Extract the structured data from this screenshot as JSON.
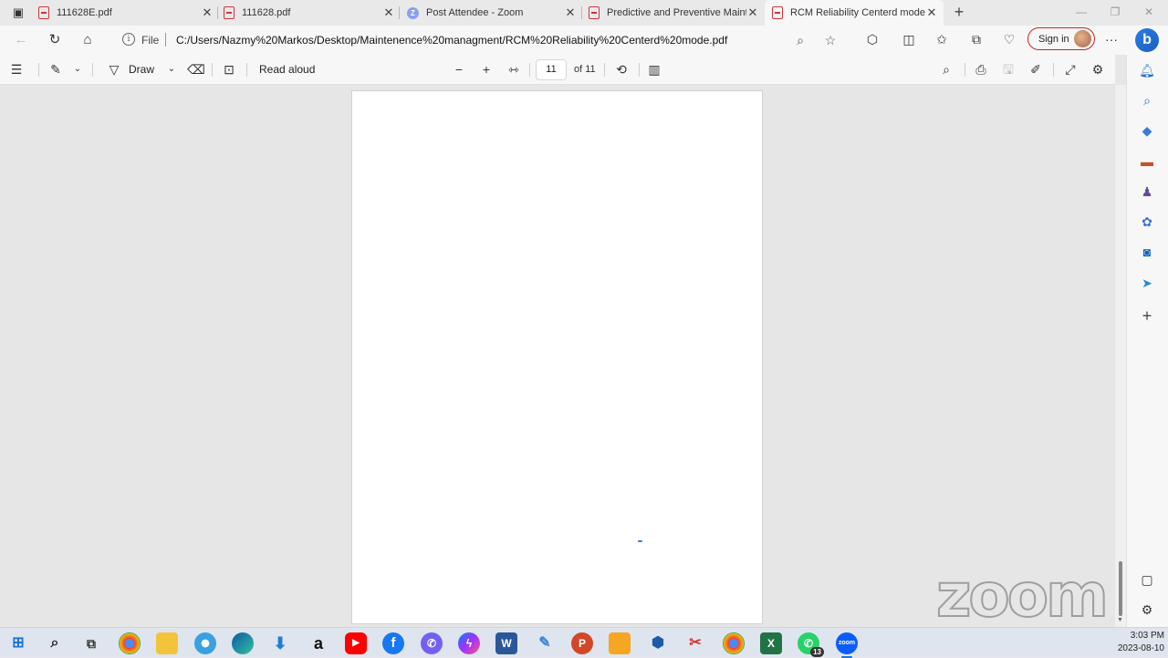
{
  "tabs": [
    {
      "title": "111628E.pdf",
      "icon": "pdf-icon"
    },
    {
      "title": "111628.pdf",
      "icon": "pdf-icon"
    },
    {
      "title": "Post Attendee - Zoom",
      "icon": "zoom-icon"
    },
    {
      "title": "Predictive and Preventive Mainte",
      "icon": "pdf-icon"
    },
    {
      "title": "RCM Reliability Centerd mode.pd",
      "icon": "pdf-icon",
      "active": true
    }
  ],
  "address": {
    "scheme": "File",
    "url": "C:/Users/Nazmy%20Markos/Desktop/Maintenence%20managment/RCM%20Reliability%20Centerd%20mode.pdf"
  },
  "profile": {
    "signin_label": "Sign in"
  },
  "pdf_toolbar": {
    "draw_label": "Draw",
    "read_aloud_label": "Read aloud",
    "current_page": "11",
    "page_count_label": "of 11"
  },
  "watermark": {
    "text": "zoom"
  },
  "taskbar": {
    "apps": [
      "start",
      "search",
      "task-view",
      "chrome",
      "file-explorer",
      "edge-legacy",
      "edge",
      "download-manager",
      "amazon",
      "youtube",
      "facebook",
      "viber",
      "messenger",
      "word",
      "paint",
      "powerpoint",
      "files",
      "app-3d",
      "app-snip",
      "chrome-alt",
      "excel",
      "whatsapp",
      "zoom"
    ],
    "whatsapp_badge": "13",
    "time": "3:03 PM",
    "date": "2023-08-10"
  },
  "colors": {
    "accent": "#1f6fd1",
    "signin_border": "#c4262e",
    "pdf_red": "#d13438"
  }
}
